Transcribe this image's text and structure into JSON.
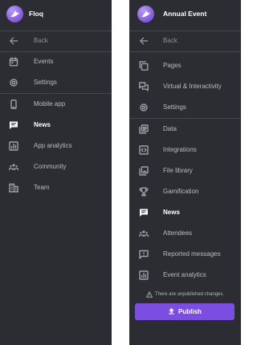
{
  "left_sidebar": {
    "app_title": "Floq",
    "items": [
      {
        "label": "Back",
        "icon": "arrow-left-icon"
      },
      {
        "label": "Events",
        "icon": "calendar-icon"
      },
      {
        "label": "Settings",
        "icon": "gear-icon"
      },
      {
        "label": "Mobile app",
        "icon": "phone-icon"
      },
      {
        "label": "News",
        "icon": "message-icon",
        "active": true
      },
      {
        "label": "App analytics",
        "icon": "chart-icon"
      },
      {
        "label": "Community",
        "icon": "people-icon"
      },
      {
        "label": "Team",
        "icon": "building-icon"
      }
    ]
  },
  "right_sidebar": {
    "event_title": "Annual Event",
    "items": [
      {
        "label": "Back",
        "icon": "arrow-left-icon"
      },
      {
        "label": "Pages",
        "icon": "pages-icon"
      },
      {
        "label": "Virtual & Interactivity",
        "icon": "chat-bubbles-icon"
      },
      {
        "label": "Settings",
        "icon": "gear-icon"
      },
      {
        "label": "Data",
        "icon": "data-icon"
      },
      {
        "label": "Integrations",
        "icon": "code-box-icon"
      },
      {
        "label": "File library",
        "icon": "image-library-icon"
      },
      {
        "label": "Gamification",
        "icon": "trophy-icon"
      },
      {
        "label": "News",
        "icon": "message-icon",
        "active": true
      },
      {
        "label": "Attendees",
        "icon": "people-icon"
      },
      {
        "label": "Reported messages",
        "icon": "report-icon"
      },
      {
        "label": "Event analytics",
        "icon": "chart-icon"
      }
    ],
    "unpublished_notice": "There are unpublished changes.",
    "publish_label": "Publish"
  },
  "colors": {
    "sidebar_bg": "#2c2d33",
    "accent": "#7b4ee0",
    "active_text": "#ffffff",
    "muted_text": "#b9bbc4"
  }
}
